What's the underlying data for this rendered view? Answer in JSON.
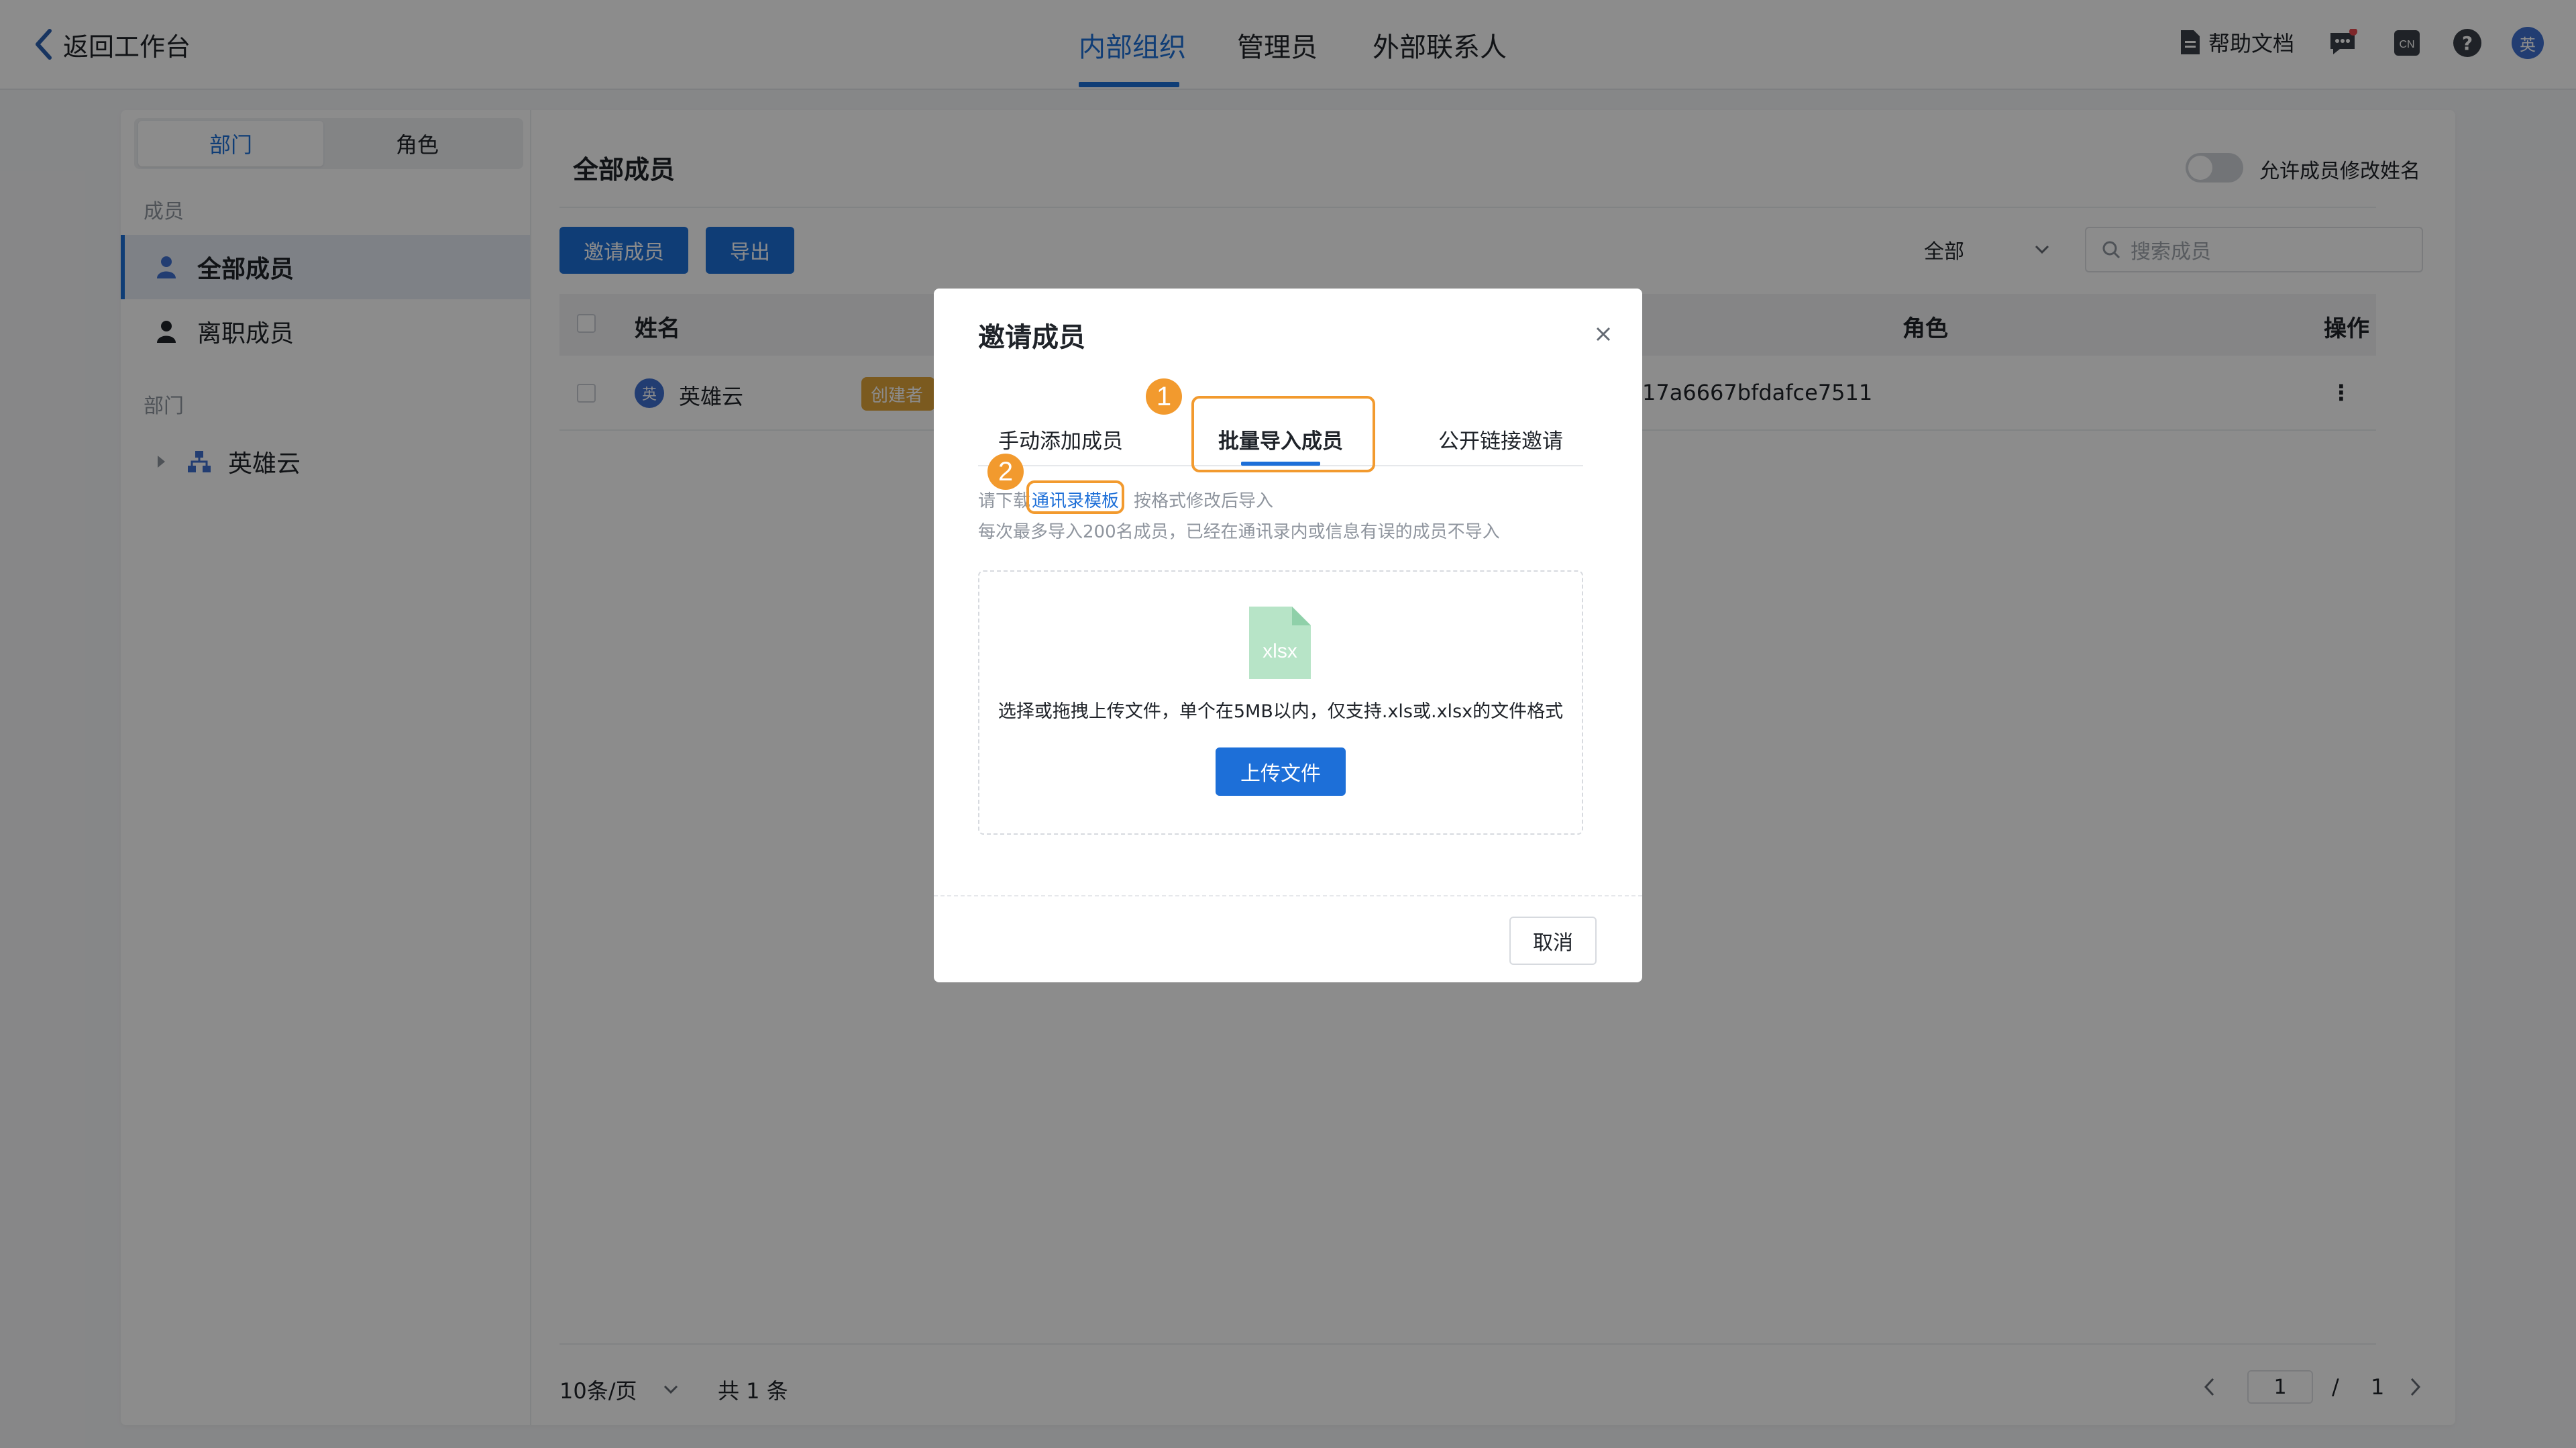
{
  "topbar": {
    "back_label": "返回工作台",
    "tabs": [
      {
        "label": "内部组织",
        "active": true
      },
      {
        "label": "管理员",
        "active": false
      },
      {
        "label": "外部联系人",
        "active": false
      }
    ],
    "help_doc": "帮助文档",
    "lang_badge": "CN",
    "help_symbol": "?",
    "avatar_char": "英",
    "accent_color": "#1d6fd8"
  },
  "sidebar": {
    "segments": [
      "部门",
      "角色"
    ],
    "members_label": "成员",
    "items": [
      {
        "label": "全部成员",
        "active": true
      },
      {
        "label": "离职成员",
        "active": false
      }
    ],
    "dept_label": "部门",
    "dept_tree": [
      {
        "label": "英雄云"
      }
    ]
  },
  "content": {
    "title": "全部成员",
    "toggle_label": "允许成员修改姓名",
    "toggle_on": false,
    "invite_button": "邀请成员",
    "export_button": "导出",
    "filter_value": "全部",
    "search_placeholder": "搜索成员",
    "table": {
      "columns": [
        "姓名",
        "角色",
        "操作"
      ],
      "rows": [
        {
          "avatar": "英",
          "name": "英雄云",
          "badge": "创建者",
          "id_fragment": "17a6667bfdafce7511",
          "more": "⋮"
        }
      ]
    },
    "footer": {
      "page_size": "10条/页",
      "total": "共 1 条",
      "current_page": "1",
      "separator": "/",
      "total_pages": "1"
    }
  },
  "modal": {
    "title": "邀请成员",
    "tabs": [
      {
        "label": "手动添加成员",
        "active": false
      },
      {
        "label": "批量导入成员",
        "active": true
      },
      {
        "label": "公开链接邀请",
        "active": false
      }
    ],
    "hint_prefix": "请下载",
    "template_link": "通讯录模板",
    "hint_suffix": "按格式修改后导入",
    "hint_line2": "每次最多导入200名成员，已经在通讯录内或信息有误的成员不导入",
    "file_icon_text": "xlsx",
    "dropzone_text": "选择或拖拽上传文件，单个在5MB以内，仅支持.xls或.xlsx的文件格式",
    "upload_button": "上传文件",
    "cancel_button": "取消",
    "callouts": [
      "1",
      "2"
    ],
    "callout_color": "#f29a2e"
  }
}
